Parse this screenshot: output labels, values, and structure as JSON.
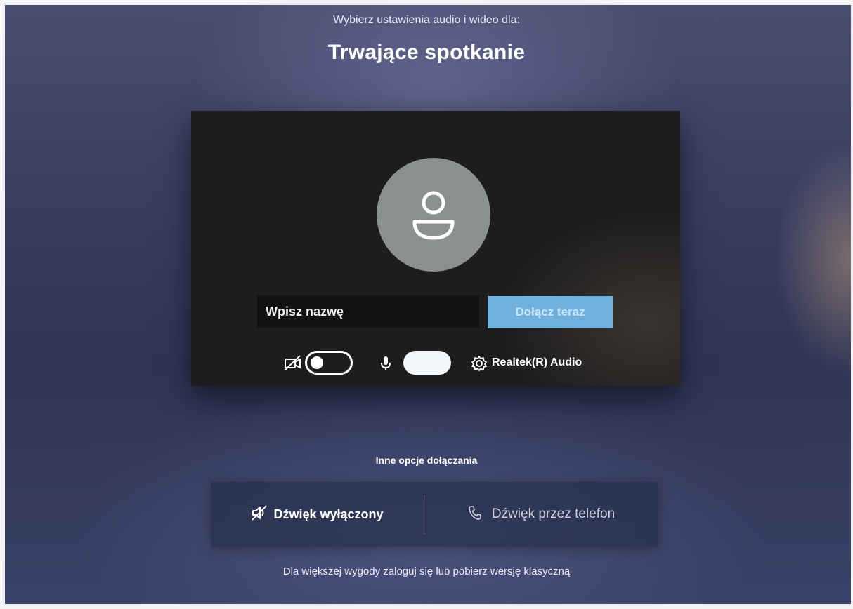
{
  "header": {
    "subtitle": "Wybierz ustawienia audio i wideo dla:",
    "title": "Trwające spotkanie"
  },
  "preview": {
    "avatar_icon": "user-icon",
    "name_input": {
      "value": "",
      "placeholder": "Wpisz nazwę"
    },
    "join_button": "Dołącz teraz",
    "camera": {
      "icon": "camera-off-icon",
      "enabled": false
    },
    "microphone": {
      "icon": "microphone-icon",
      "enabled": true
    },
    "device": {
      "icon": "gear-icon",
      "label": "Realtek(R) Audio"
    }
  },
  "other_options": {
    "heading": "Inne opcje dołączania",
    "audio_off": {
      "icon": "speaker-off-icon",
      "label": "Dźwięk wyłączony"
    },
    "phone_audio": {
      "icon": "phone-icon",
      "label": "Dźwięk przez telefon"
    }
  },
  "footer": {
    "text": "Dla większej wygody zaloguj się lub pobierz wersję klasyczną"
  },
  "colors": {
    "accent": "#6fb0dd",
    "avatar_bg": "#8a918d",
    "card_bg": "#1c1b1d"
  }
}
